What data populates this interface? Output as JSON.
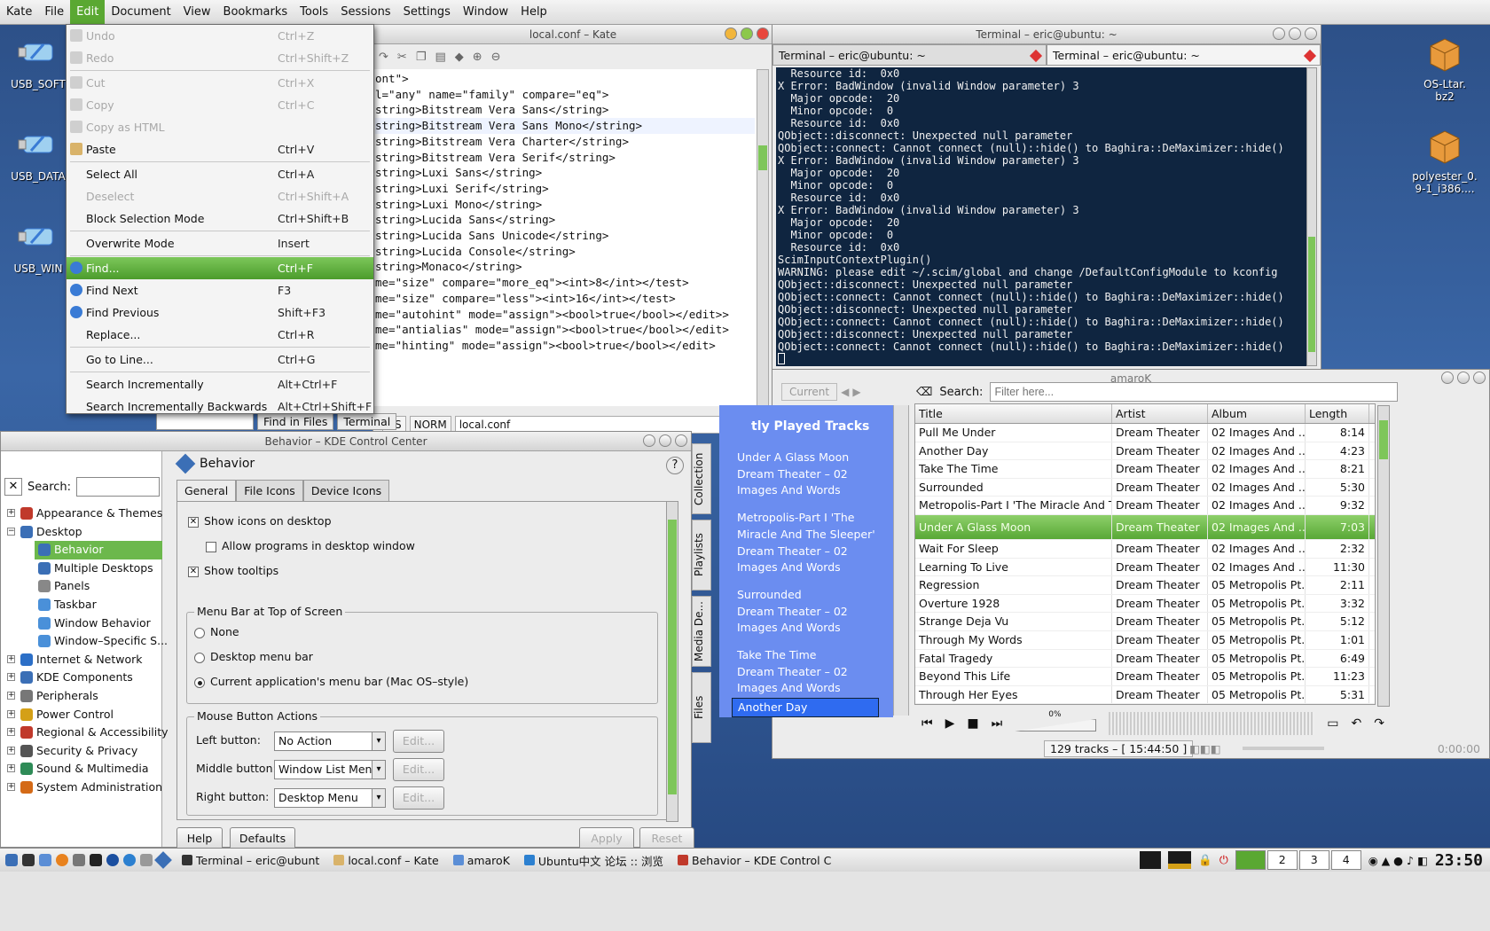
{
  "menubar": [
    "Kate",
    "File",
    "Edit",
    "Document",
    "View",
    "Bookmarks",
    "Tools",
    "Sessions",
    "Settings",
    "Window",
    "Help"
  ],
  "desktop_icons": {
    "left": [
      "USB_SOFT",
      "USB_DATA",
      "USB_WIN"
    ],
    "right": [
      "OS-Ltar.\nbz2",
      "polyester_0.\n9-1_i386...."
    ]
  },
  "kate": {
    "title": "local.conf – Kate",
    "code": [
      "ont\">",
      "l=\"any\" name=\"family\" compare=\"eq\">",
      "string>Bitstream Vera Sans</string>",
      "string>Bitstream Vera Sans Mono</string>",
      "string>Bitstream Vera Charter</string>",
      "string>Bitstream Vera Serif</string>",
      "string>Luxi Sans</string>",
      "string>Luxi Serif</string>",
      "string>Luxi Mono</string>",
      "string>Lucida Sans</string>",
      "string>Lucida Sans Unicode</string>",
      "string>Lucida Console</string>",
      "string>Monaco</string>",
      "",
      "me=\"size\" compare=\"more_eq\"><int>8</int></test>",
      "me=\"size\" compare=\"less\"><int>16</int></test>",
      "me=\"autohint\" mode=\"assign\"><bool>true</bool></edit>>",
      "me=\"antialias\" mode=\"assign\"><bool>true</bool></edit>",
      "me=\"hinting\" mode=\"assign\"><bool>true</bool></edit>"
    ],
    "status": [
      "NS",
      "NORM",
      "local.conf"
    ],
    "bottom_tabs": [
      "Find in Files",
      "Terminal"
    ]
  },
  "edit_menu": [
    {
      "label": "Undo",
      "acc": "Ctrl+Z",
      "dis": true,
      "icon": "undo-icon"
    },
    {
      "label": "Redo",
      "acc": "Ctrl+Shift+Z",
      "dis": true,
      "icon": "redo-icon"
    },
    {
      "sep": true
    },
    {
      "label": "Cut",
      "acc": "Ctrl+X",
      "dis": true,
      "icon": "cut-icon"
    },
    {
      "label": "Copy",
      "acc": "Ctrl+C",
      "dis": true,
      "icon": "copy-icon"
    },
    {
      "label": "Copy as HTML",
      "acc": "",
      "dis": true,
      "icon": "copy-html-icon"
    },
    {
      "label": "Paste",
      "acc": "Ctrl+V",
      "dis": false,
      "icon": "paste-icon"
    },
    {
      "sep": true
    },
    {
      "label": "Select All",
      "acc": "Ctrl+A",
      "dis": false
    },
    {
      "label": "Deselect",
      "acc": "Ctrl+Shift+A",
      "dis": true
    },
    {
      "label": "Block Selection Mode",
      "acc": "Ctrl+Shift+B",
      "dis": false
    },
    {
      "sep": true
    },
    {
      "label": "Overwrite Mode",
      "acc": "Insert",
      "dis": false
    },
    {
      "sep": true
    },
    {
      "label": "Find...",
      "acc": "Ctrl+F",
      "dis": false,
      "sel": true,
      "icon": "find-icon"
    },
    {
      "label": "Find Next",
      "acc": "F3",
      "dis": false,
      "icon": "find-next-icon"
    },
    {
      "label": "Find Previous",
      "acc": "Shift+F3",
      "dis": false,
      "icon": "find-previous-icon"
    },
    {
      "label": "Replace...",
      "acc": "Ctrl+R",
      "dis": false
    },
    {
      "sep": true
    },
    {
      "label": "Go to Line...",
      "acc": "Ctrl+G",
      "dis": false
    },
    {
      "sep": true
    },
    {
      "label": "Search Incrementally",
      "acc": "Alt+Ctrl+F",
      "dis": false
    },
    {
      "label": "Search Incrementally Backwards",
      "acc": "Alt+Ctrl+Shift+F",
      "dis": false
    }
  ],
  "terminal": {
    "title": "Terminal – eric@ubuntu: ~",
    "tabs": [
      "Terminal – eric@ubuntu: ~",
      "Terminal – eric@ubuntu: ~"
    ],
    "lines": [
      "  Resource id:  0x0",
      "X Error: BadWindow (invalid Window parameter) 3",
      "  Major opcode:  20",
      "  Minor opcode:  0",
      "  Resource id:  0x0",
      "QObject::disconnect: Unexpected null parameter",
      "QObject::connect: Cannot connect (null)::hide() to Baghira::DeMaximizer::hide()",
      "X Error: BadWindow (invalid Window parameter) 3",
      "  Major opcode:  20",
      "  Minor opcode:  0",
      "  Resource id:  0x0",
      "X Error: BadWindow (invalid Window parameter) 3",
      "  Major opcode:  20",
      "  Minor opcode:  0",
      "  Resource id:  0x0",
      "ScimInputContextPlugin()",
      "WARNING: please edit ~/.scim/global and change /DefaultConfigModule to kconfig",
      "QObject::disconnect: Unexpected null parameter",
      "QObject::connect: Cannot connect (null)::hide() to Baghira::DeMaximizer::hide()",
      "QObject::disconnect: Unexpected null parameter",
      "QObject::connect: Cannot connect (null)::hide() to Baghira::DeMaximizer::hide()",
      "QObject::disconnect: Unexpected null parameter",
      "QObject::connect: Cannot connect (null)::hide() to Baghira::DeMaximizer::hide()"
    ]
  },
  "kcc": {
    "title": "Behavior – KDE Control Center",
    "search_label": "Search:",
    "tree": [
      {
        "label": "Appearance & Themes",
        "exp": "+",
        "color": "#c0392b"
      },
      {
        "label": "Desktop",
        "exp": "−",
        "color": "#3b6fb6"
      },
      {
        "label": "Behavior",
        "child": true,
        "sel": true,
        "color": "#3b6fb6"
      },
      {
        "label": "Multiple Desktops",
        "child": true,
        "color": "#3b6fb6"
      },
      {
        "label": "Panels",
        "child": true,
        "color": "#888"
      },
      {
        "label": "Taskbar",
        "child": true,
        "color": "#4a90d9"
      },
      {
        "label": "Window Behavior",
        "child": true,
        "color": "#4a90d9"
      },
      {
        "label": "Window–Specific S...",
        "child": true,
        "color": "#4a90d9"
      },
      {
        "label": "Internet & Network",
        "exp": "+",
        "color": "#2c6fc7"
      },
      {
        "label": "KDE Components",
        "exp": "+",
        "color": "#3b6fb6"
      },
      {
        "label": "Peripherals",
        "exp": "+",
        "color": "#777"
      },
      {
        "label": "Power Control",
        "exp": "+",
        "color": "#d4a017"
      },
      {
        "label": "Regional & Accessibility",
        "exp": "+",
        "color": "#c0392b"
      },
      {
        "label": "Security & Privacy",
        "exp": "+",
        "color": "#555"
      },
      {
        "label": "Sound & Multimedia",
        "exp": "+",
        "color": "#2e8b57"
      },
      {
        "label": "System Administration",
        "exp": "+",
        "color": "#d46a17"
      }
    ],
    "module_title": "Behavior",
    "tabs": [
      "General",
      "File Icons",
      "Device Icons"
    ],
    "checks": [
      {
        "label": "Show icons on desktop",
        "on": true
      },
      {
        "label": "Allow programs in desktop window",
        "on": false
      },
      {
        "label": "Show tooltips",
        "on": true
      }
    ],
    "menu_group": "Menu Bar at Top of Screen",
    "radios": [
      {
        "label": "None",
        "on": false
      },
      {
        "label": "Desktop menu bar",
        "on": false
      },
      {
        "label": "Current application's menu bar (Mac OS–style)",
        "on": true
      }
    ],
    "mouse_group": "Mouse Button Actions",
    "mouse": [
      {
        "label": "Left button:",
        "value": "No Action",
        "edit": "Edit..."
      },
      {
        "label": "Middle button:",
        "value": "Window List Menu",
        "edit": "Edit..."
      },
      {
        "label": "Right button:",
        "value": "Desktop Menu",
        "edit": "Edit..."
      }
    ],
    "buttons": {
      "help": "Help",
      "defaults": "Defaults",
      "apply": "Apply",
      "reset": "Reset"
    }
  },
  "amarok": {
    "title": "amaroK",
    "search_label": "Search:",
    "search_placeholder": "Filter here...",
    "current_tab": "Current",
    "side_tabs": [
      "Collection",
      "Playlists",
      "Media De...",
      "Files"
    ],
    "ctx_heading": "tly Played Tracks",
    "ctx_items": [
      "Under A Glass Moon\nDream Theater – 02\nImages And Words",
      "Metropolis-Part I 'The\nMiracle And The Sleeper'\nDream Theater – 02\nImages And Words",
      "Surrounded\nDream Theater – 02\nImages And Words",
      "Take The Time\nDream Theater – 02\nImages And Words"
    ],
    "ctx_selected": "Another Day",
    "columns": [
      "Title",
      "Artist",
      "Album",
      "Length"
    ],
    "rows": [
      [
        "Pull Me Under",
        "Dream Theater",
        "02 Images And ...",
        "8:14"
      ],
      [
        "Another Day",
        "Dream Theater",
        "02 Images And ...",
        "4:23"
      ],
      [
        "Take The Time",
        "Dream Theater",
        "02 Images And ...",
        "8:21"
      ],
      [
        "Surrounded",
        "Dream Theater",
        "02 Images And ...",
        "5:30"
      ],
      [
        "Metropolis-Part I 'The Miracle And The ...",
        "Dream Theater",
        "02 Images And ...",
        "9:32"
      ],
      [
        "Under A Glass Moon",
        "Dream Theater",
        "02 Images And ...",
        "7:03"
      ],
      [
        "Wait For Sleep",
        "Dream Theater",
        "02 Images And ...",
        "2:32"
      ],
      [
        "Learning To Live",
        "Dream Theater",
        "02 Images And ...",
        "11:30"
      ],
      [
        "Regression",
        "Dream Theater",
        "05 Metropolis Pt....",
        "2:11"
      ],
      [
        "Overture 1928",
        "Dream Theater",
        "05 Metropolis Pt....",
        "3:32"
      ],
      [
        "Strange Deja Vu",
        "Dream Theater",
        "05 Metropolis Pt....",
        "5:12"
      ],
      [
        "Through My Words",
        "Dream Theater",
        "05 Metropolis Pt....",
        "1:01"
      ],
      [
        "Fatal Tragedy",
        "Dream Theater",
        "05 Metropolis Pt....",
        "6:49"
      ],
      [
        "Beyond This Life",
        "Dream Theater",
        "05 Metropolis Pt....",
        "11:23"
      ],
      [
        "Through Her Eyes",
        "Dream Theater",
        "05 Metropolis Pt....",
        "5:31"
      ]
    ],
    "current_row": 5,
    "volume": "0%",
    "status": "129 tracks – [ 15:44:50 ]",
    "time": "0:00:00"
  },
  "taskbar": {
    "tasks": [
      "Terminal – eric@ubunt",
      "local.conf – Kate",
      "amaroK",
      "Ubuntu中文 论坛 :: 浏览",
      "Behavior – KDE Control C"
    ],
    "pager": [
      "2",
      "3",
      "4"
    ],
    "clock": "23:50"
  }
}
